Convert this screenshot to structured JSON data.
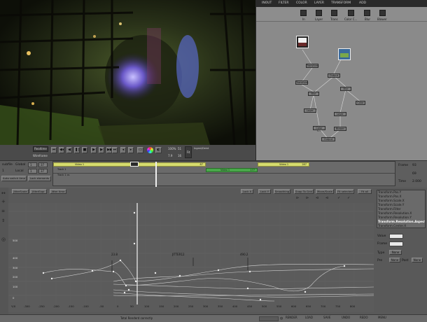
{
  "node_tabs": [
    "INOUT",
    "FILTER",
    "COLOR",
    "LAYER",
    "TRANSFORM",
    "ADD"
  ],
  "node_tools": [
    "In",
    "Layer",
    "Trans",
    "Color C...",
    "Blur",
    "Blower"
  ],
  "nodes": [
    "Transform",
    "Output",
    "Transform",
    "Blur",
    "Blur",
    "Color",
    "Layer",
    "Layer",
    "Color C...",
    "Blower",
    "Color",
    "Output"
  ],
  "viewer": {
    "realtime": "Realtime",
    "wireframe": "Wireframe",
    "zoom": "100%",
    "frame_value": "51",
    "rate": "7.9",
    "fps": "16",
    "fit_label": "Fit",
    "tiny_label": "Ingest/Deint"
  },
  "timeline": {
    "left_label": "subfile",
    "global_label": "Global",
    "global_in": "1",
    "global_out": "37",
    "local_label": "Local",
    "local_in": "1",
    "local_out": "37",
    "auto_switch": "Auto switch time",
    "lock_elements": "Lock elements",
    "clips": [
      {
        "label": "Video 1",
        "num": "87"
      },
      {
        "label": "Video 1",
        "num": "177"
      },
      {
        "label": "Video 1",
        "num": "287"
      }
    ],
    "track_label": "Track 1",
    "track_sub": "Track 1 cs",
    "frame_label": "Frame",
    "frame_value": "93",
    "rate_value": "69",
    "time_label": "Time",
    "time_value": "2.000"
  },
  "curve_toolbar": {
    "left": [
      "JitterScale",
      "JitterExpr",
      "Jitter time"
    ],
    "right": [
      "Lock X",
      "Lock Y",
      "Smoothing",
      "Snap To Grid",
      "Move/Scale",
      "Fit selected",
      "Fit all"
    ]
  },
  "curve_editor": {
    "xlabel": "Y/X",
    "x_ticks": [
      "-300",
      "-250",
      "-200",
      "-150",
      "-100",
      "-50",
      "0",
      "50",
      "100",
      "150",
      "200",
      "250",
      "300",
      "350",
      "400",
      "450",
      "500",
      "550",
      "600",
      "650",
      "700",
      "750",
      "800"
    ],
    "y_ticks": [
      "0",
      "100",
      "200",
      "300",
      "400",
      "500"
    ],
    "markers": [
      "23.8",
      "JITTER12",
      "490.2"
    ]
  },
  "params": [
    "Transform.Pos.Y",
    "Transform.Pos.X",
    "Transform.Scale.X",
    "Transform.Scale.Y",
    "Transform.Filter",
    "Transform.Resolution.X",
    "Transform.Resolution.Y",
    "Transform.Resolution.Aspect",
    "Transform.Center.X"
  ],
  "inspector": {
    "value_label": "Value",
    "frame_label": "Frame",
    "type_label": "Type",
    "type_value": "None",
    "pre_label": "Pre",
    "pre_value": "None",
    "post_label": "Post",
    "post_value": "None"
  },
  "status": {
    "message": "Total Renderd correctly",
    "buttons": [
      "RENDER",
      "LOAD",
      "SAVE",
      "UNDO",
      "REDO",
      "MENU"
    ]
  }
}
